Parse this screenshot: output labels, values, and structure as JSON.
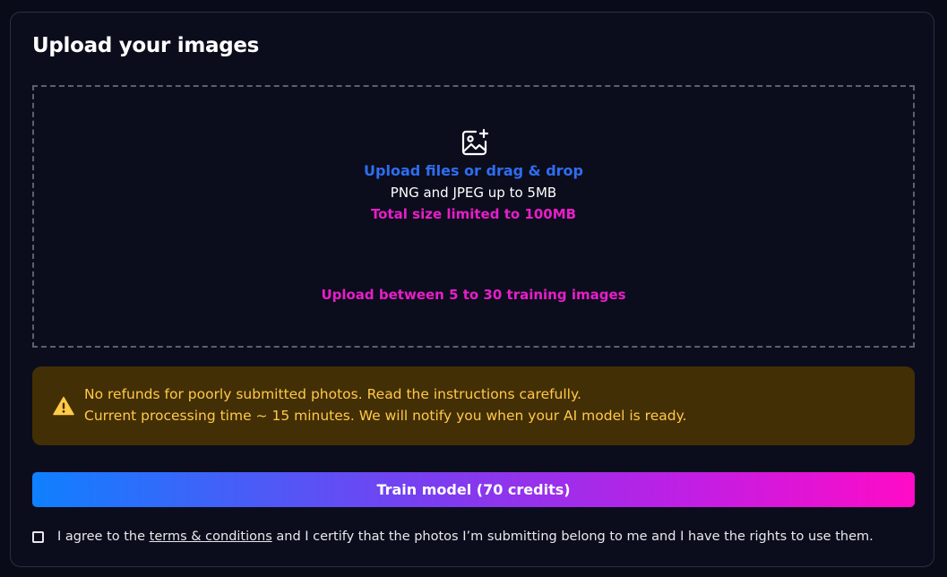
{
  "card": {
    "title": "Upload your images"
  },
  "dropzone": {
    "icon": "image-plus-icon",
    "upload_link": "Upload files or drag & drop",
    "formats": "PNG and JPEG up to 5MB",
    "size_limit": "Total size limited to 100MB",
    "image_count": "Upload between 5 to 30 training images"
  },
  "alert": {
    "icon": "warning-triangle-icon",
    "line1": "No refunds for poorly submitted photos. Read the instructions carefully.",
    "line2": "Current processing time ~ 15 minutes. We will notify you when your AI model is ready."
  },
  "train_button": {
    "label": "Train model (70 credits)"
  },
  "agreement": {
    "checked": false,
    "prefix": "I agree to the",
    "terms_link": "terms & conditions",
    "suffix": "and I certify that the photos I’m submitting belong to me and I have the rights to use them."
  },
  "colors": {
    "background": "#090b18",
    "accent_blue": "#2f6df0",
    "accent_pink": "#e81ec9",
    "alert_bg": "#432f05",
    "alert_text": "#ffc94a"
  }
}
